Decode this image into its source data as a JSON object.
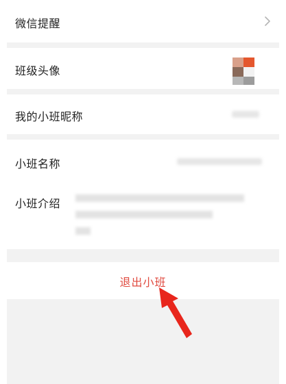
{
  "settings": {
    "wechat_reminder": "微信提醒",
    "class_avatar": "班级头像",
    "my_class_nickname": "我的小班昵称",
    "class_name": "小班名称",
    "class_intro": "小班介绍"
  },
  "actions": {
    "exit_class": "退出小班"
  },
  "colors": {
    "exit_text": "#e04a3f",
    "arrow": "#e8261c",
    "background": "#f2f2f2"
  },
  "icons": {
    "reminder_chevron": "chevron-right-icon",
    "annotation": "red-arrow-icon"
  }
}
